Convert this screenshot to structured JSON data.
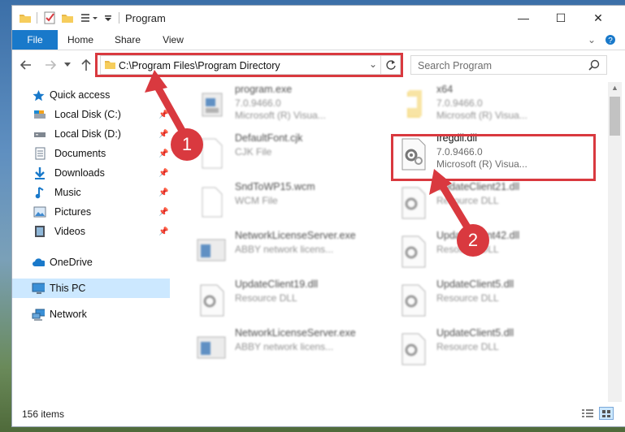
{
  "window": {
    "title": "Program",
    "minimize": "—",
    "maximize": "☐",
    "close": "✕"
  },
  "ribbon": {
    "tabs": [
      "File",
      "Home",
      "Share",
      "View"
    ]
  },
  "address": {
    "path": "C:\\Program Files\\Program Directory"
  },
  "search": {
    "placeholder": "Search Program"
  },
  "sidebar": {
    "quick_access": "Quick access",
    "items": [
      {
        "label": "Local Disk (C:)",
        "icon": "drive-icon",
        "pinned": true
      },
      {
        "label": "Local Disk (D:)",
        "icon": "drive-icon",
        "pinned": true
      },
      {
        "label": "Documents",
        "icon": "documents-icon",
        "pinned": true
      },
      {
        "label": "Downloads",
        "icon": "downloads-icon",
        "pinned": true
      },
      {
        "label": "Music",
        "icon": "music-icon",
        "pinned": true
      },
      {
        "label": "Pictures",
        "icon": "pictures-icon",
        "pinned": true
      },
      {
        "label": "Videos",
        "icon": "videos-icon",
        "pinned": true
      }
    ],
    "onedrive": "OneDrive",
    "this_pc": "This PC",
    "network": "Network"
  },
  "files": [
    {
      "name": "program.exe",
      "line2": "7.0.9466.0",
      "line3": "Microsoft (R) Visua...",
      "icon": "exe-icon"
    },
    {
      "name": "x64",
      "line2": "7.0.9466.0",
      "line3": "Microsoft (R) Visua...",
      "icon": "folder-icon"
    },
    {
      "name": "DefaultFont.cjk",
      "line2": "CJK File",
      "line3": "",
      "icon": "file-icon"
    },
    {
      "name": "Iregdll.dll",
      "line2": "7.0.9466.0",
      "line3": "Microsoft (R) Visua...",
      "icon": "dll-gear-icon",
      "highlighted": true
    },
    {
      "name": "SndToWP15.wcm",
      "line2": "WCM File",
      "line3": "",
      "icon": "file-icon"
    },
    {
      "name": "UpdateClient21.dll",
      "line2": "Resource DLL",
      "line3": "",
      "icon": "dll-gear-icon"
    },
    {
      "name": "NetworkLicenseServer.exe",
      "line2": "ABBY network licens...",
      "line3": "",
      "icon": "app-window-icon"
    },
    {
      "name": "UpdateClient42.dll",
      "line2": "Resource DLL",
      "line3": "",
      "icon": "dll-gear-icon"
    },
    {
      "name": "UpdateClient19.dll",
      "line2": "Resource DLL",
      "line3": "",
      "icon": "dll-gear-icon"
    },
    {
      "name": "UpdateClient5.dll",
      "line2": "Resource DLL",
      "line3": "",
      "icon": "dll-gear-icon"
    },
    {
      "name": "NetworkLicenseServer.exe",
      "line2": "ABBY network licens...",
      "line3": "",
      "icon": "app-window-icon"
    },
    {
      "name": "UpdateClient5.dll",
      "line2": "Resource DLL",
      "line3": "",
      "icon": "dll-gear-icon"
    }
  ],
  "status": {
    "item_count": "156 items"
  },
  "annotations": {
    "step1": "1",
    "step2": "2",
    "color": "#d9393f"
  },
  "colors": {
    "accent": "#1979ca",
    "selection": "#cce8ff"
  }
}
